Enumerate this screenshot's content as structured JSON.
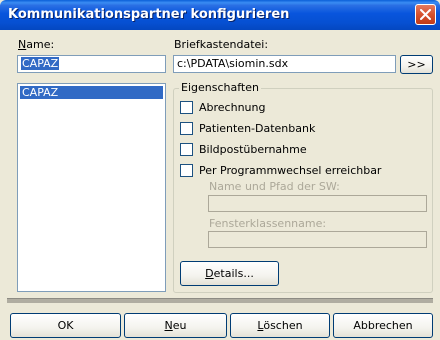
{
  "window": {
    "title": "Kommunikationspartner konfigurieren"
  },
  "name_field": {
    "label": "Name:",
    "value": "CAPAZ"
  },
  "mailbox_field": {
    "label": "Briefkastendatei:",
    "value": "c:\\PDATA\\siomin.sdx",
    "browse_label": ">>"
  },
  "partner_list": {
    "items": [
      "CAPAZ"
    ],
    "selected": "CAPAZ"
  },
  "properties": {
    "title": "Eigenschaften",
    "checkboxes": [
      {
        "label": "Abrechnung",
        "checked": false
      },
      {
        "label": "Patienten-Datenbank",
        "checked": false
      },
      {
        "label": "Bildpostübernahme",
        "checked": false
      },
      {
        "label": "Per Programmwechsel erreichbar",
        "checked": false
      }
    ],
    "sw_path_label": "Name und Pfad der SW:",
    "sw_path_value": "",
    "window_class_label": "Fensterklassenname:",
    "window_class_value": "",
    "details_label": "Details..."
  },
  "footer": {
    "ok_label": "OK",
    "new_label": "Neu",
    "delete_label": "Löschen",
    "cancel_label": "Abbrechen"
  },
  "colors": {
    "title_bar": "#0855dd",
    "selection": "#316ac5",
    "dialog_bg": "#ece9d8",
    "close_button": "#d6512e"
  }
}
